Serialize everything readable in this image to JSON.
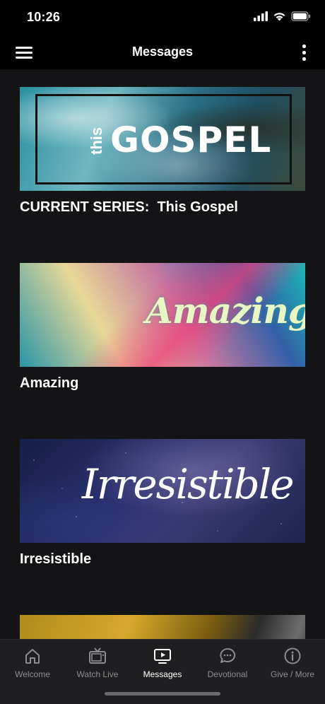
{
  "status": {
    "time": "10:26"
  },
  "nav": {
    "title": "Messages"
  },
  "cards": [
    {
      "title": "CURRENT SERIES:  This Gospel",
      "banner_small": "this",
      "banner_text": "GOSPEL"
    },
    {
      "title": "Amazing",
      "banner_text": "Amazing"
    },
    {
      "title": "Irresistible",
      "banner_text": "Irresistible"
    },
    {
      "title": ""
    }
  ],
  "tabs": [
    {
      "label": "Welcome",
      "icon": "home-icon",
      "active": false
    },
    {
      "label": "Watch Live",
      "icon": "tv-icon",
      "active": false
    },
    {
      "label": "Messages",
      "icon": "play-screen-icon",
      "active": true
    },
    {
      "label": "Devotional",
      "icon": "chat-icon",
      "active": false
    },
    {
      "label": "Give / More",
      "icon": "info-icon",
      "active": false
    }
  ],
  "colors": {
    "background": "#141416",
    "bar": "#000000",
    "tab_inactive": "#8d8d90",
    "tab_active": "#ffffff"
  }
}
